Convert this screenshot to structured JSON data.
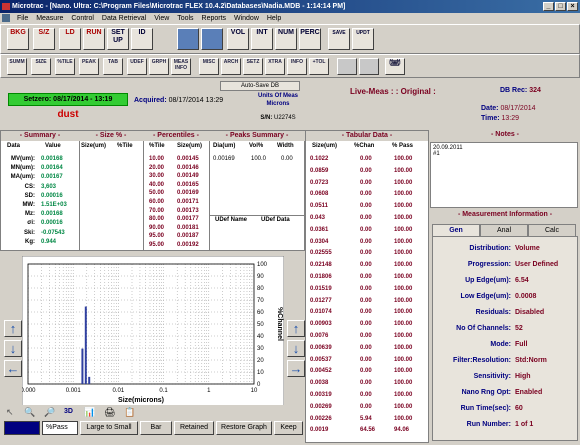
{
  "window": {
    "title": "Microtrac - [Nano. Ultra: C:\\Program Files\\Microtrac FLEX 10.4.2\\Databases\\Nadia.MDB - 1:14:14 PM]",
    "min": "_",
    "max": "□",
    "close": "×"
  },
  "menu": [
    "File",
    "Measure",
    "Control",
    "Data Retrieval",
    "View",
    "Tools",
    "Reports",
    "Window",
    "Help"
  ],
  "toolbar1": {
    "left": [
      "BKG",
      "S/Z",
      "LD",
      "RUN",
      "SET UP",
      "ID"
    ],
    "right": [
      "",
      "",
      "VOL",
      "INT",
      "NUM",
      "PERC"
    ],
    "save": "SAVE",
    "updt": "UPDT"
  },
  "toolbar2": [
    "SUMM",
    "SIZE",
    "%TILE",
    "PEAK",
    "TAB",
    "UDEF",
    "GRPH",
    "MEAS INFO",
    "MISC",
    "ARCH",
    "SETZ",
    "XTRA",
    "INFO",
    "+TOL",
    "",
    "",
    "PRINT"
  ],
  "header": {
    "autosave": "Auto-Save DB",
    "setzero": "Setzero: 08/17/2014 - 13:19",
    "sample": "dust",
    "acquired_label": "Acquired:",
    "acquired_date": "08/17/2014",
    "acquired_time": "13:29",
    "units_label": "Units Of Meas",
    "units_value": "Microns",
    "sn_label": "S/N:",
    "sn_value": "U2274S",
    "live_meas": "Live-Meas : : Original :",
    "db_rec_label": "DB Rec:",
    "db_rec_value": "324",
    "date_label": "Date:",
    "date_value": "08/17/2014",
    "time_label": "Time:",
    "time_value": "13:29"
  },
  "summary": {
    "title": "- Summary -",
    "headers": [
      "Data",
      "Value"
    ],
    "rows": [
      {
        "label": "MV(um):",
        "value": "0.00168"
      },
      {
        "label": "MN(um):",
        "value": "0.00164"
      },
      {
        "label": "MA(um):",
        "value": "0.00167"
      },
      {
        "label": "CS:",
        "value": "3,603"
      },
      {
        "label": "SD:",
        "value": "0.00016"
      },
      {
        "label": "MW:",
        "value": "1.51E+03"
      },
      {
        "label": "Mz:",
        "value": "0.00168"
      },
      {
        "label": "σi:",
        "value": "0.00016"
      },
      {
        "label": "Ski:",
        "value": "-0.07543"
      },
      {
        "label": "Kg:",
        "value": "0.944"
      }
    ]
  },
  "size_pct": {
    "title": "- Size % -",
    "headers": [
      "Size(um)",
      "%Tile"
    ]
  },
  "percentiles": {
    "title": "- Percentiles -",
    "headers": [
      "%Tile",
      "Size(um)"
    ],
    "rows": [
      {
        "tile": "10.00",
        "size": "0.00145"
      },
      {
        "tile": "20.00",
        "size": "0.00146"
      },
      {
        "tile": "30.00",
        "size": "0.00149"
      },
      {
        "tile": "40.00",
        "size": "0.00165"
      },
      {
        "tile": "50.00",
        "size": "0.00169"
      },
      {
        "tile": "60.00",
        "size": "0.00171"
      },
      {
        "tile": "70.00",
        "size": "0.00173"
      },
      {
        "tile": "80.00",
        "size": "0.00177"
      },
      {
        "tile": "90.00",
        "size": "0.00181"
      },
      {
        "tile": "95.00",
        "size": "0.00187"
      },
      {
        "tile": "95.00",
        "size": "0.00192"
      }
    ]
  },
  "peaks": {
    "title": "- Peaks Summary -",
    "headers": [
      "Dia(um)",
      "Vol%",
      "Width"
    ],
    "row": {
      "dia": "0.00169",
      "vol": "100.0",
      "width": "0.00"
    },
    "udef_headers": [
      "UDef Name",
      "UDef Data"
    ]
  },
  "tabular": {
    "title": "- Tabular Data -",
    "headers": [
      "Size(um)",
      "%Chan",
      "% Pass"
    ],
    "rows": [
      {
        "size": "0.1022",
        "chan": "0.00",
        "pass": "100.00"
      },
      {
        "size": "0.0859",
        "chan": "0.00",
        "pass": "100.00"
      },
      {
        "size": "0.0723",
        "chan": "0.00",
        "pass": "100.00"
      },
      {
        "size": "0.0608",
        "chan": "0.00",
        "pass": "100.00"
      },
      {
        "size": "0.0511",
        "chan": "0.00",
        "pass": "100.00"
      },
      {
        "size": "0.043",
        "chan": "0.00",
        "pass": "100.00"
      },
      {
        "size": "0.0361",
        "chan": "0.00",
        "pass": "100.00"
      },
      {
        "size": "0.0304",
        "chan": "0.00",
        "pass": "100.00"
      },
      {
        "size": "0.02555",
        "chan": "0.00",
        "pass": "100.00"
      },
      {
        "size": "0.02148",
        "chan": "0.00",
        "pass": "100.00"
      },
      {
        "size": "0.01806",
        "chan": "0.00",
        "pass": "100.00"
      },
      {
        "size": "0.01519",
        "chan": "0.00",
        "pass": "100.00"
      },
      {
        "size": "0.01277",
        "chan": "0.00",
        "pass": "100.00"
      },
      {
        "size": "0.01074",
        "chan": "0.00",
        "pass": "100.00"
      },
      {
        "size": "0.00903",
        "chan": "0.00",
        "pass": "100.00"
      },
      {
        "size": "0.0076",
        "chan": "0.00",
        "pass": "100.00"
      },
      {
        "size": "0.00639",
        "chan": "0.00",
        "pass": "100.00"
      },
      {
        "size": "0.00537",
        "chan": "0.00",
        "pass": "100.00"
      },
      {
        "size": "0.00452",
        "chan": "0.00",
        "pass": "100.00"
      },
      {
        "size": "0.0038",
        "chan": "0.00",
        "pass": "100.00"
      },
      {
        "size": "0.00319",
        "chan": "0.00",
        "pass": "100.00"
      },
      {
        "size": "0.00269",
        "chan": "0.00",
        "pass": "100.00"
      },
      {
        "size": "0.00226",
        "chan": "5.94",
        "pass": "100.00"
      },
      {
        "size": "0.0019",
        "chan": "64.56",
        "pass": "94.06"
      }
    ]
  },
  "notes": {
    "title": "- Notes -",
    "line1": "20.09.2011",
    "line2": "#1"
  },
  "meas_info": {
    "title": "- Measurement Information -",
    "tabs": [
      "Gen",
      "Anal",
      "Calc"
    ],
    "rows": [
      {
        "label": "Distribution:",
        "value": "Volume"
      },
      {
        "label": "Progression:",
        "value": "User Defined"
      },
      {
        "label": "Up Edge(um):",
        "value": "6.54"
      },
      {
        "label": "Low Edge(um):",
        "value": "0.0008"
      },
      {
        "label": "Residuals:",
        "value": "Disabled"
      },
      {
        "label": "No Of Channels:",
        "value": "52"
      },
      {
        "label": "Mode:",
        "value": "Full"
      },
      {
        "label": "Filter:Resolution:",
        "value": "Std:Norm"
      },
      {
        "label": "Sensitivity:",
        "value": "High"
      },
      {
        "label": "Nano Rng Opt:",
        "value": "Enabled"
      },
      {
        "label": "Run Time(sec):",
        "value": "60"
      },
      {
        "label": "Run Number:",
        "value": "1    of  1"
      }
    ]
  },
  "chart_data": {
    "type": "bar",
    "xlabel": "Size(microns)",
    "ylabel": "%Channel",
    "x_ticks": [
      "0.000",
      "0.001",
      "0.01",
      "0.1",
      "1",
      "10"
    ],
    "y_ticks": [
      "0",
      "10",
      "20",
      "30",
      "40",
      "50",
      "60",
      "70",
      "80",
      "90",
      "100"
    ],
    "ylim": [
      0,
      100
    ],
    "xscale": "log",
    "bars": [
      {
        "x": 0.00226,
        "value": 5.94
      },
      {
        "x": 0.0019,
        "value": 64.56
      },
      {
        "x": 0.0016,
        "value": 29.5
      }
    ]
  },
  "bottom": {
    "pass_label": "%Pass",
    "buttons": [
      "Large to Small",
      "Bar",
      "Retained",
      "Restore Graph",
      "Keep"
    ],
    "mode_3d": "3D"
  }
}
